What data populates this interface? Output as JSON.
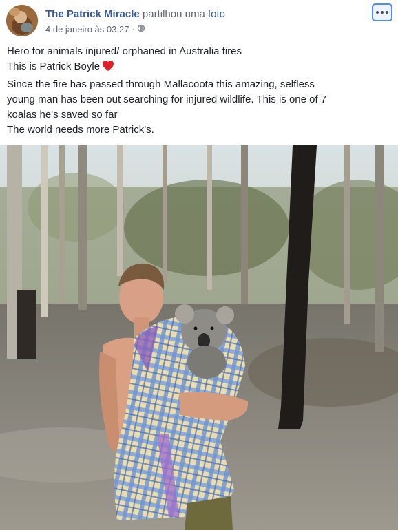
{
  "post": {
    "author": "The Patrick Miracle",
    "action_prefix": "partilhou uma",
    "action_link": "foto",
    "timestamp": "4 de janeiro às 03:27 ·",
    "privacy_icon": "globe-icon",
    "more_icon": "more-options-icon",
    "text_lines": [
      "Hero for animals injured/ orphaned in Australia fires",
      "This is Patrick Boyle",
      "Since the fire has passed through Mallacoota this amazing, selfless",
      "young man has been out searching for injured wildlife. This is one of 7",
      "koalas he's saved so far",
      "The world needs more Patrick's."
    ],
    "heart_icon": "red-heart-emoji",
    "colors": {
      "link": "#365899",
      "meta": "#616770",
      "heart": "#e02027",
      "more_button_border": "#4c8ef7"
    }
  }
}
